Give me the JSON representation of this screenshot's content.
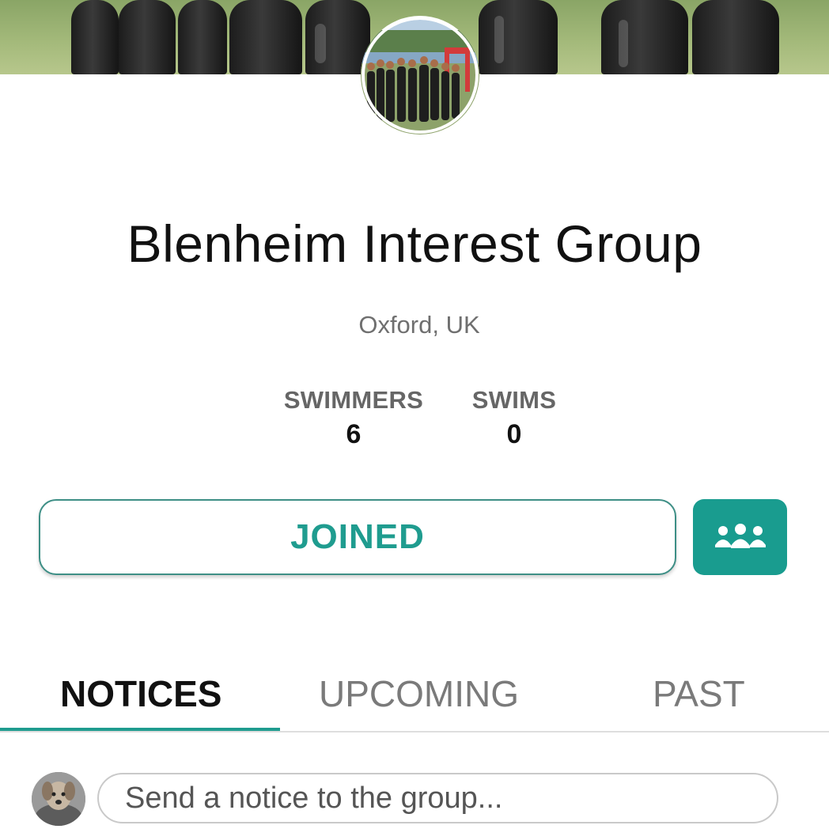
{
  "group": {
    "name": "Blenheim Interest Group",
    "location": "Oxford, UK"
  },
  "stats": {
    "swimmers_label": "SWIMMERS",
    "swimmers_value": "6",
    "swims_label": "SWIMS",
    "swims_value": "0"
  },
  "actions": {
    "joined_label": "JOINED",
    "members_icon": "group-members-icon"
  },
  "tabs": [
    {
      "label": "NOTICES",
      "active": true
    },
    {
      "label": "UPCOMING",
      "active": false
    },
    {
      "label": "PAST",
      "active": false
    }
  ],
  "composer": {
    "placeholder": "Send a notice to the group..."
  },
  "colors": {
    "accent": "#1f9c8f",
    "tab_inactive": "#7a7a7a",
    "location_text": "#6f6f6f"
  }
}
